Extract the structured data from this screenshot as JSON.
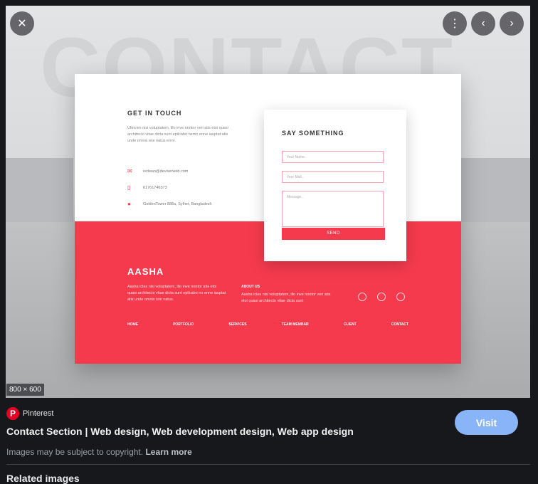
{
  "viewer": {
    "bg_word": "CONTACT",
    "size_badge": "800 × 600"
  },
  "mockup": {
    "get_in_touch": "GET IN TOUCH",
    "get_in_touch_body": "Ultricies nisi voluptatem, illo inve nnntor veri atis etoi quasi architecto vitae dicta sunt epilcabo nemo enne iauptat atis unde omnis iste natus error.",
    "email": "redwan@deviserweb.com",
    "phone": "01761746373",
    "address": "GoldenTower 888a, Sylhet, Bangladesh",
    "say_something": "SAY SOMETHING",
    "name_placeholder": "Your Name..",
    "mail_placeholder": "Your Mail..",
    "message_placeholder": "Message..",
    "send": "SEND",
    "brand": "AASHA",
    "brand_body": "Aasha icles nisi voluptatem, illo inve nnntor atis etoi quasi architecto vitae dicta sunt epilcabo no enne iauptat atis unde omnis iste natus.",
    "about_title": "ABOUT US",
    "about_body": "Aasha icles nisi voluptatem, illo inve nnntor veri atis etoi quasi architecto vitae dicta sunt",
    "nav": [
      "HOME",
      "PORTFOLIO",
      "SERVICES",
      "TEAM MEMBAR",
      "CLIENT",
      "CONTACT"
    ],
    "accent": "#f63a4e"
  },
  "source": {
    "site": "Pinterest",
    "title": "Contact Section | Web design, Web development design, Web app design",
    "copyright": "Images may be subject to copyright.",
    "learn_more": "Learn more",
    "visit": "Visit"
  },
  "related_heading": "Related images"
}
